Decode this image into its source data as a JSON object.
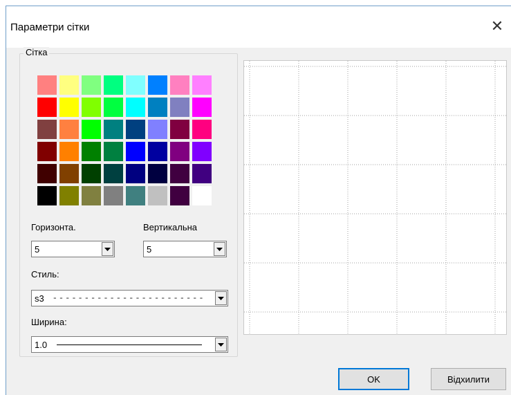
{
  "dialog": {
    "title": "Параметри сітки",
    "close_glyph": "✕"
  },
  "group": {
    "label": "Сітка"
  },
  "palette": {
    "colors": [
      "#ff8080",
      "#ffff80",
      "#80ff80",
      "#00ff80",
      "#80ffff",
      "#0080ff",
      "#ff80c0",
      "#ff80ff",
      "#ff0000",
      "#ffff00",
      "#80ff00",
      "#00ff40",
      "#00ffff",
      "#0080c0",
      "#8080c0",
      "#ff00ff",
      "#804040",
      "#ff8040",
      "#00ff00",
      "#008080",
      "#004080",
      "#8080ff",
      "#800040",
      "#ff0080",
      "#800000",
      "#ff8000",
      "#008000",
      "#008040",
      "#0000ff",
      "#0000a0",
      "#800080",
      "#8000ff",
      "#400000",
      "#804000",
      "#004000",
      "#004040",
      "#000080",
      "#000040",
      "#400040",
      "#400080",
      "#000000",
      "#808000",
      "#808040",
      "#808080",
      "#408080",
      "#c0c0c0",
      "#400040",
      "#ffffff"
    ]
  },
  "horizontal": {
    "label": "Горизонта.",
    "value": "5"
  },
  "vertical": {
    "label": "Вертикальна",
    "value": "5"
  },
  "style": {
    "label": "Стиль:",
    "value": "s3",
    "sample": "------------------------"
  },
  "width": {
    "label": "Ширина:",
    "value": "1.0"
  },
  "buttons": {
    "ok": "OK",
    "cancel": "Відхилити"
  },
  "preview": {
    "columns": 5,
    "rows": 5,
    "line_style": "dotted",
    "line_color": "#a0a0a0"
  }
}
